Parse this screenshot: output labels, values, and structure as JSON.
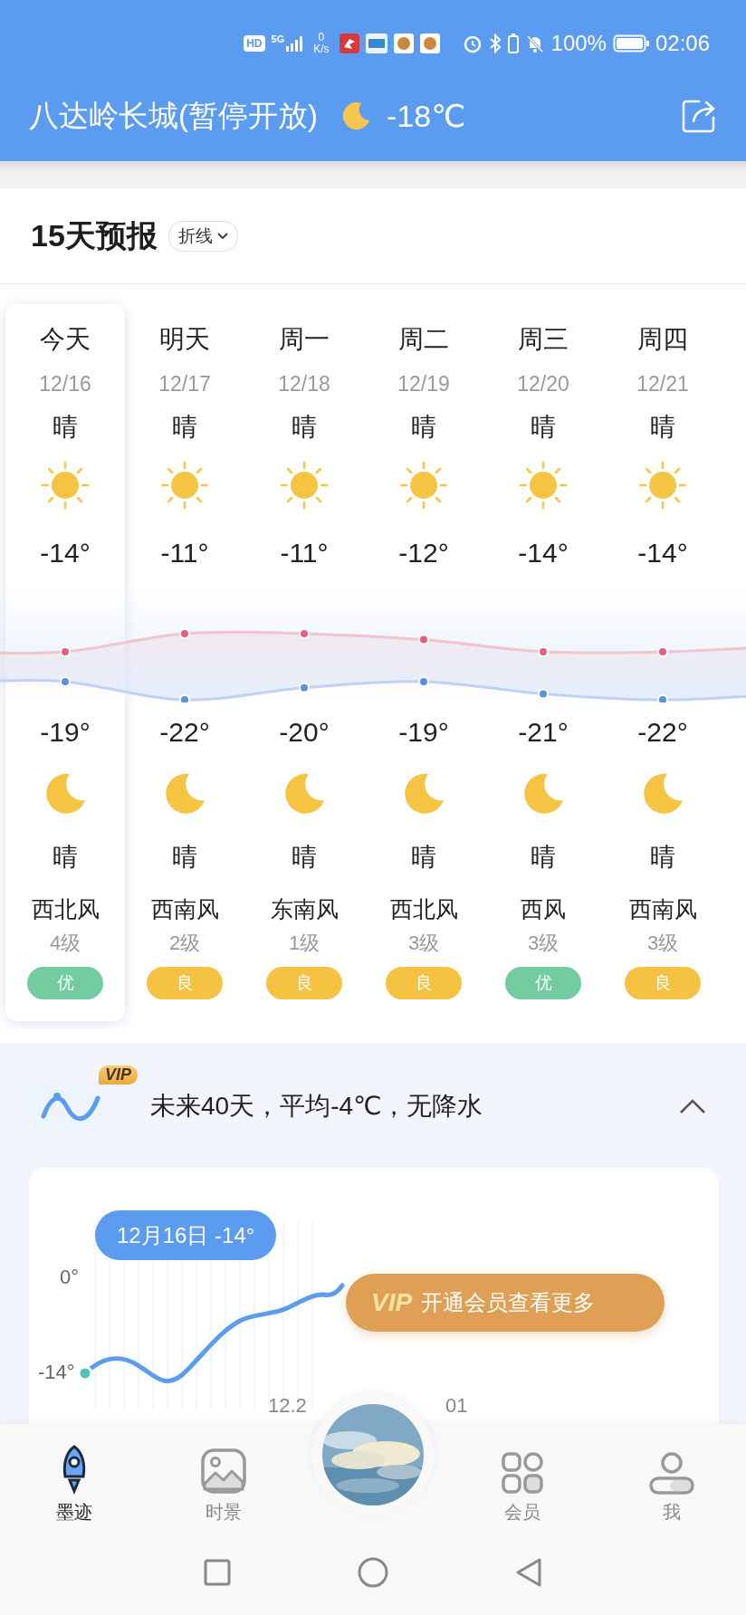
{
  "status_bar": {
    "hd": "HD",
    "network": "5G",
    "speed_value": "0",
    "speed_unit": "K/s",
    "battery": "100%",
    "time": "02:06"
  },
  "header": {
    "location": "八达岭长城(暂停开放)",
    "temperature": "-18℃"
  },
  "forecast": {
    "title": "15天预报",
    "mode": "折线",
    "days": [
      {
        "day": "今天",
        "date": "12/16",
        "day_condition": "晴",
        "high": "-14°",
        "low": "-19°",
        "night_condition": "晴",
        "wind": "西北风",
        "wind_level": "4级",
        "aqi": {
          "label": "优",
          "color": "#72cc9f"
        },
        "selected": true
      },
      {
        "day": "明天",
        "date": "12/17",
        "day_condition": "晴",
        "high": "-11°",
        "low": "-22°",
        "night_condition": "晴",
        "wind": "西南风",
        "wind_level": "2级",
        "aqi": {
          "label": "良",
          "color": "#f5c341"
        },
        "selected": false
      },
      {
        "day": "周一",
        "date": "12/18",
        "day_condition": "晴",
        "high": "-11°",
        "low": "-20°",
        "night_condition": "晴",
        "wind": "东南风",
        "wind_level": "1级",
        "aqi": {
          "label": "良",
          "color": "#f5c341"
        },
        "selected": false
      },
      {
        "day": "周二",
        "date": "12/19",
        "day_condition": "晴",
        "high": "-12°",
        "low": "-19°",
        "night_condition": "晴",
        "wind": "西北风",
        "wind_level": "3级",
        "aqi": {
          "label": "良",
          "color": "#f5c341"
        },
        "selected": false
      },
      {
        "day": "周三",
        "date": "12/20",
        "day_condition": "晴",
        "high": "-14°",
        "low": "-21°",
        "night_condition": "晴",
        "wind": "西风",
        "wind_level": "3级",
        "aqi": {
          "label": "优",
          "color": "#72cc9f"
        },
        "selected": false
      },
      {
        "day": "周四",
        "date": "12/21",
        "day_condition": "晴",
        "high": "-14°",
        "low": "-22°",
        "night_condition": "晴",
        "wind": "西南风",
        "wind_level": "3级",
        "aqi": {
          "label": "良",
          "color": "#f5c341"
        },
        "selected": false
      }
    ]
  },
  "outlook": {
    "badge": "VIP",
    "summary": "未来40天，平均-4℃，无降水",
    "expanded": true,
    "tooltip": "12月16日 -14°",
    "y_labels": [
      "0°",
      "-14°"
    ],
    "x_labels": [
      "12.2",
      "01"
    ],
    "promo": {
      "badge": "VIP",
      "label": "开通会员查看更多"
    }
  },
  "nav": [
    {
      "label": "墨迹",
      "selected": true
    },
    {
      "label": "时景",
      "selected": false
    },
    {
      "label": "会员",
      "selected": false
    },
    {
      "label": "我",
      "selected": false
    }
  ]
}
